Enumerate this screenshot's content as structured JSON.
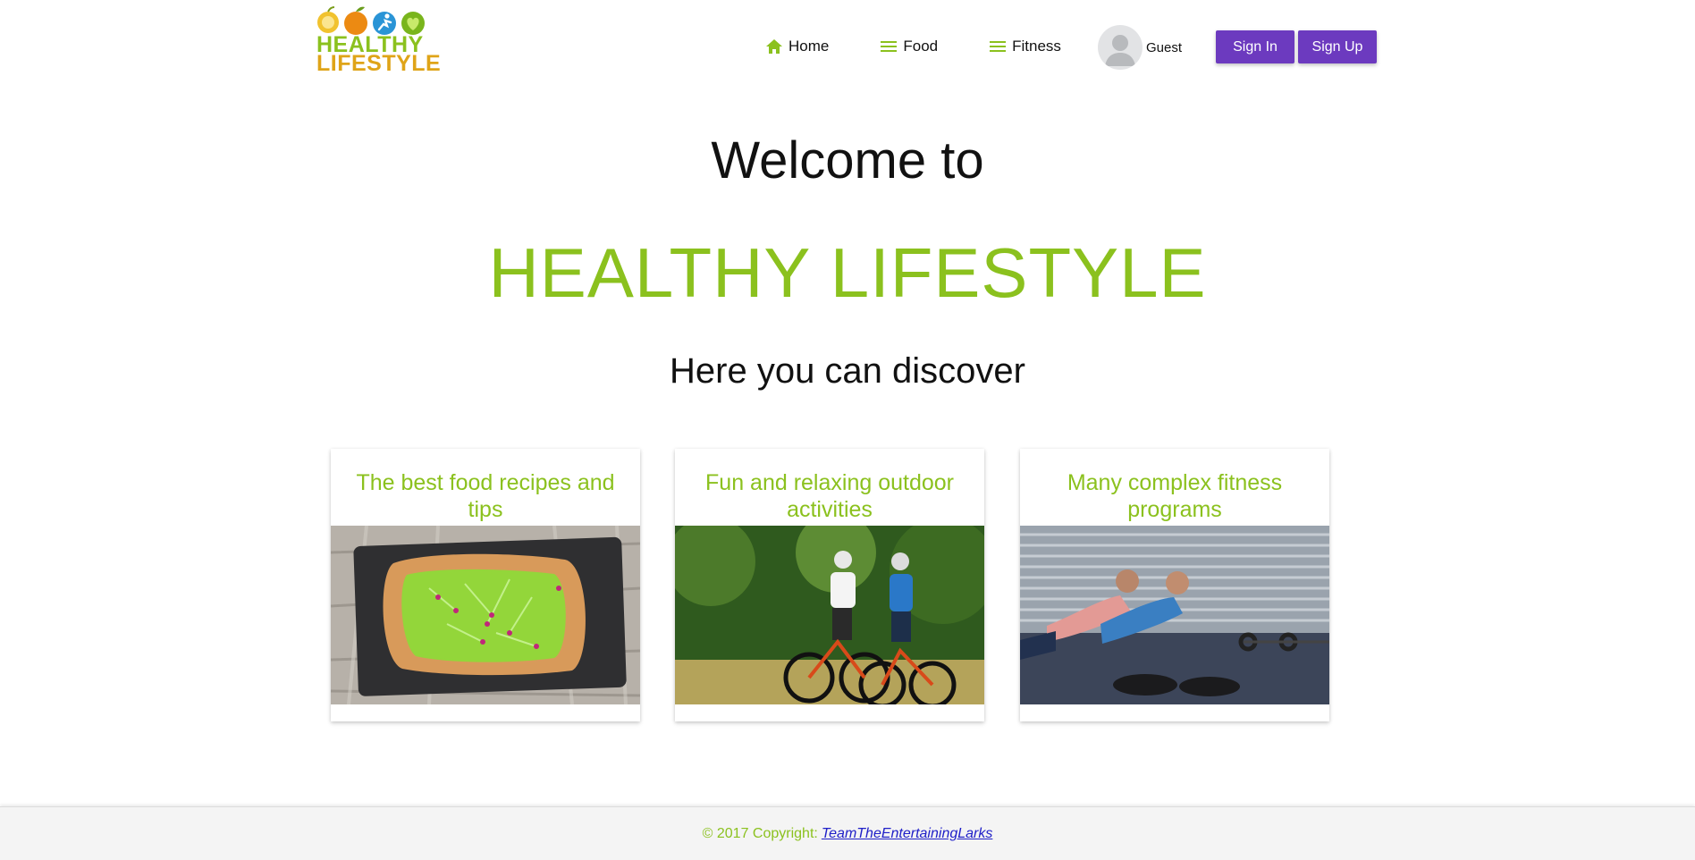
{
  "logo": {
    "line1": "HEALTHY",
    "line2": "LIFESTYLE",
    "icons": [
      "apple-icon",
      "orange-fruit-icon",
      "runner-icon",
      "heart-icon"
    ]
  },
  "nav": {
    "home": "Home",
    "food": "Food",
    "fitness": "Fitness",
    "guest": "Guest",
    "signin": "Sign In",
    "signup": "Sign Up"
  },
  "hero": {
    "welcome": "Welcome to",
    "brand": "HEALTHY LIFESTYLE",
    "discover": "Here you can discover"
  },
  "cards": [
    {
      "title": "The best food recipes and tips",
      "image": "avocado-toast-photo"
    },
    {
      "title": "Fun and relaxing outdoor activities",
      "image": "cycling-couple-photo"
    },
    {
      "title": "Many complex fitness programs",
      "image": "gym-workout-photo"
    }
  ],
  "footer": {
    "copyright": "© 2017 Copyright:",
    "link": "TeamTheEntertainingLarks"
  },
  "colors": {
    "accent_green": "#8bc11e",
    "logo_orange": "#dfa418",
    "button_purple": "#6c3abf",
    "link_blue": "#2020c8"
  }
}
